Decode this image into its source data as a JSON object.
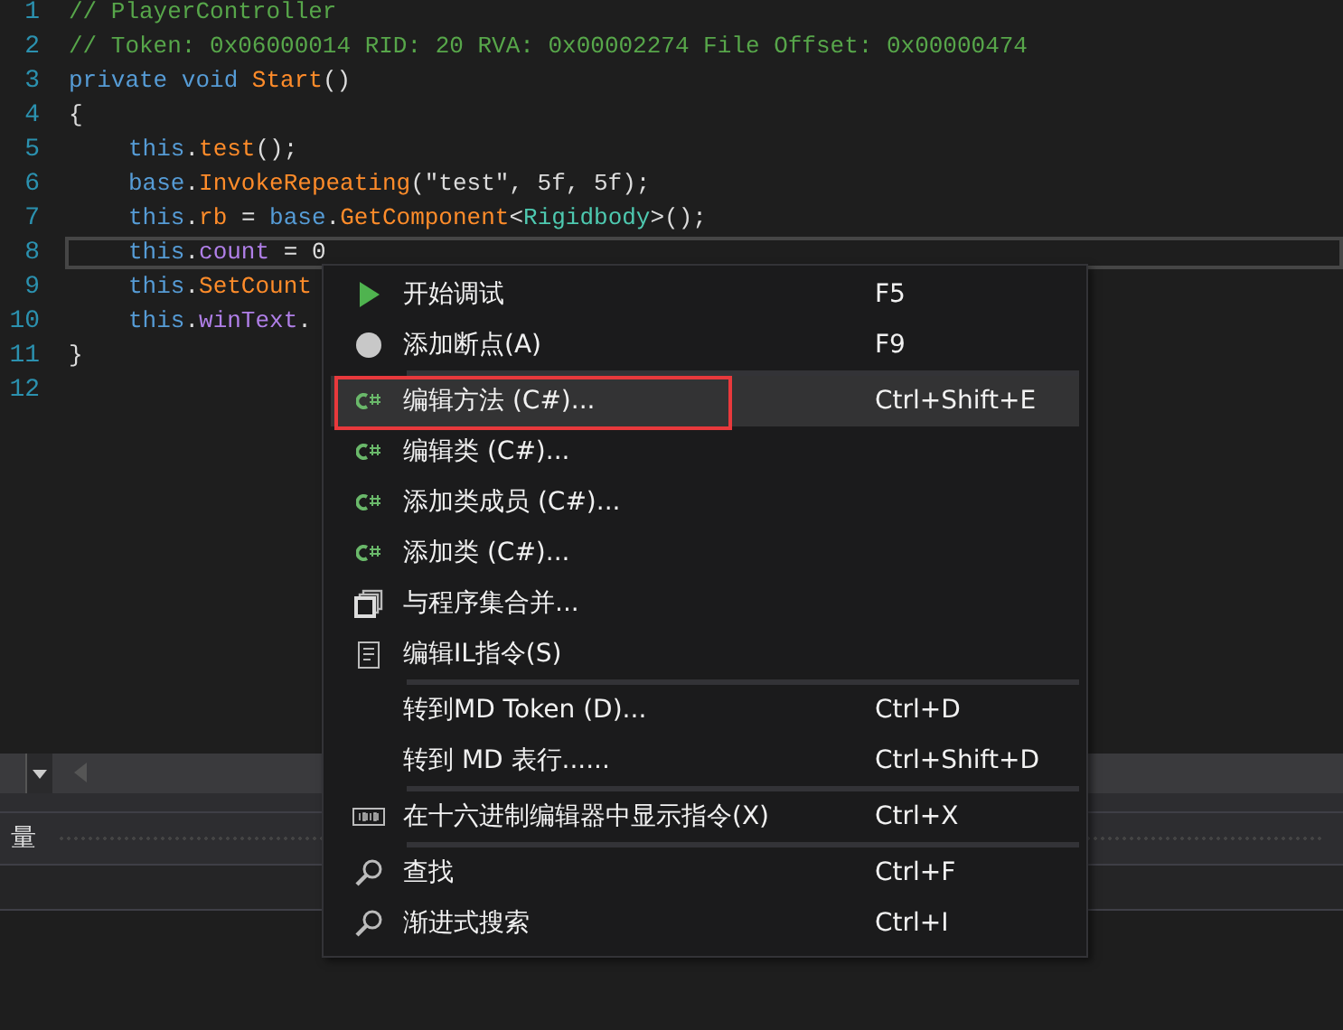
{
  "editor": {
    "lines": [
      {
        "number": "1",
        "current": false,
        "indented": false,
        "tokens": [
          {
            "text": "// PlayerController",
            "kind": "comment"
          }
        ]
      },
      {
        "number": "2",
        "current": false,
        "indented": false,
        "tokens": [
          {
            "text": "// Token: 0x06000014 RID: 20 RVA: 0x00002274 File Offset: 0x00000474",
            "kind": "comment"
          }
        ]
      },
      {
        "number": "3",
        "current": false,
        "indented": false,
        "tokens": [
          {
            "text": "private void ",
            "kind": "keyword"
          },
          {
            "text": "Start",
            "kind": "method"
          },
          {
            "text": "()",
            "kind": "plain"
          }
        ]
      },
      {
        "number": "4",
        "current": false,
        "indented": false,
        "tokens": [
          {
            "text": "{",
            "kind": "plain"
          }
        ]
      },
      {
        "number": "5",
        "current": false,
        "indented": true,
        "tokens": [
          {
            "text": "this",
            "kind": "keyword"
          },
          {
            "text": ".",
            "kind": "plain"
          },
          {
            "text": "test",
            "kind": "method"
          },
          {
            "text": "();",
            "kind": "plain"
          }
        ]
      },
      {
        "number": "6",
        "current": false,
        "indented": true,
        "tokens": [
          {
            "text": "base",
            "kind": "keyword"
          },
          {
            "text": ".",
            "kind": "plain"
          },
          {
            "text": "InvokeRepeating",
            "kind": "method"
          },
          {
            "text": "(\"test\", 5f, 5f);",
            "kind": "plain"
          }
        ]
      },
      {
        "number": "7",
        "current": false,
        "indented": true,
        "tokens": [
          {
            "text": "this",
            "kind": "keyword"
          },
          {
            "text": ".",
            "kind": "plain"
          },
          {
            "text": "rb",
            "kind": "method"
          },
          {
            "text": " = ",
            "kind": "plain"
          },
          {
            "text": "base",
            "kind": "keyword"
          },
          {
            "text": ".",
            "kind": "plain"
          },
          {
            "text": "GetComponent",
            "kind": "method"
          },
          {
            "text": "<",
            "kind": "plain"
          },
          {
            "text": "Rigidbody",
            "kind": "type"
          },
          {
            "text": ">();",
            "kind": "plain"
          }
        ]
      },
      {
        "number": "8",
        "current": true,
        "indented": true,
        "tokens": [
          {
            "text": "this",
            "kind": "keyword"
          },
          {
            "text": ".",
            "kind": "plain"
          },
          {
            "text": "count",
            "kind": "field"
          },
          {
            "text": " = 0",
            "kind": "plain"
          }
        ]
      },
      {
        "number": "9",
        "current": false,
        "indented": true,
        "tokens": [
          {
            "text": "this",
            "kind": "keyword"
          },
          {
            "text": ".",
            "kind": "plain"
          },
          {
            "text": "SetCount",
            "kind": "method"
          }
        ]
      },
      {
        "number": "10",
        "current": false,
        "indented": true,
        "tokens": [
          {
            "text": "this",
            "kind": "keyword"
          },
          {
            "text": ".",
            "kind": "plain"
          },
          {
            "text": "winText",
            "kind": "field"
          },
          {
            "text": ".",
            "kind": "plain"
          }
        ]
      },
      {
        "number": "11",
        "current": false,
        "indented": false,
        "tokens": [
          {
            "text": "}",
            "kind": "plain"
          }
        ]
      },
      {
        "number": "12"
      }
    ]
  },
  "bottom_panel": {
    "tab": "量"
  },
  "context_menu": {
    "items": [
      {
        "kind": "play",
        "label": "开始调试",
        "shortcut": "F5",
        "selected": false,
        "outlined": false,
        "separator_after": false
      },
      {
        "kind": "breakpoint",
        "label": "添加断点(A)",
        "shortcut": "F9",
        "selected": false,
        "outlined": false,
        "separator_after": true
      },
      {
        "kind": "csharp",
        "label": "编辑方法 (C#)...",
        "shortcut": "Ctrl+Shift+E",
        "selected": true,
        "outlined": true,
        "separator_after": false
      },
      {
        "kind": "csharp",
        "label": "编辑类 (C#)...",
        "selected": false,
        "outlined": false,
        "separator_after": false
      },
      {
        "kind": "csharp",
        "label": "添加类成员 (C#)...",
        "selected": false,
        "outlined": false,
        "separator_after": false
      },
      {
        "kind": "csharp",
        "label": "添加类 (C#)...",
        "selected": false,
        "outlined": false,
        "separator_after": false
      },
      {
        "kind": "merge",
        "label": "与程序集合并...",
        "selected": false,
        "outlined": false,
        "separator_after": false
      },
      {
        "kind": "document",
        "label": "编辑IL指令(S)",
        "selected": false,
        "outlined": false,
        "separator_after": true
      },
      {
        "kind": "plain",
        "label": "转到MD Token (D)...",
        "shortcut": "Ctrl+D",
        "selected": false,
        "outlined": false,
        "separator_after": false
      },
      {
        "kind": "plain",
        "label": "转到 MD 表行......",
        "shortcut": "Ctrl+Shift+D",
        "selected": false,
        "outlined": false,
        "separator_after": true
      },
      {
        "kind": "hex",
        "label": "在十六进制编辑器中显示指令(X)",
        "shortcut": "Ctrl+X",
        "selected": false,
        "outlined": false,
        "separator_after": true
      },
      {
        "kind": "search",
        "label": "查找",
        "shortcut": "Ctrl+F",
        "selected": false,
        "outlined": false,
        "separator_after": false
      },
      {
        "kind": "search",
        "label": "渐进式搜索",
        "shortcut": "Ctrl+I",
        "selected": false,
        "outlined": false,
        "separator_after": false
      }
    ]
  }
}
